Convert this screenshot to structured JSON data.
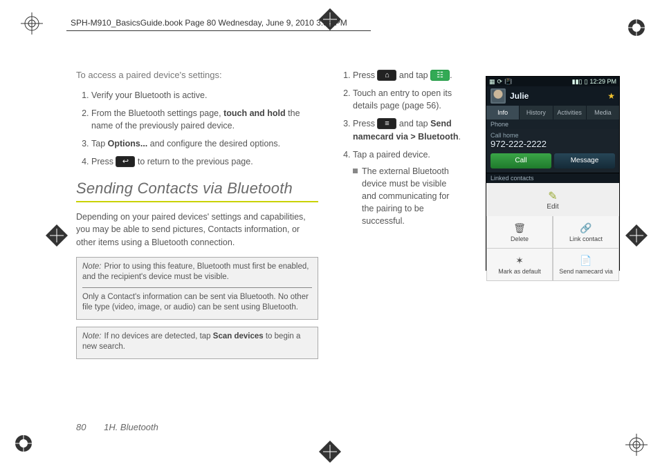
{
  "header": {
    "running_head": "SPH-M910_BasicsGuide.book  Page 80  Wednesday, June 9, 2010  3:56 PM"
  },
  "left_col": {
    "intro": "To access a paired device's settings:",
    "steps": [
      {
        "n": "1.",
        "text": "Verify your Bluetooth is active."
      },
      {
        "n": "2.",
        "text_a": "From the Bluetooth settings page, ",
        "bold": "touch and hold",
        "text_b": " the name of the previously paired device."
      },
      {
        "n": "3.",
        "text_a": "Tap ",
        "bold": "Options...",
        "text_b": " and configure the desired options."
      },
      {
        "n": "4.",
        "text_a": "Press ",
        "icon": "back-key-icon",
        "icon_glyph": "↩",
        "text_b": " to return to the previous page."
      }
    ],
    "section_title": "Sending Contacts via Bluetooth",
    "section_body": "Depending on your paired devices' settings and capabilities, you may be able to send pictures, Contacts information, or other items using a Bluetooth connection.",
    "note1_label": "Note:",
    "note1_p1": "Prior to using this feature, Bluetooth must first be enabled, and the recipient's device must be visible.",
    "note1_p2": "Only a Contact's information can be sent via Bluetooth. No other file type (video, image, or audio) can be sent using Bluetooth.",
    "note2_label": "Note:",
    "note2_p1_a": "If no devices are detected, tap ",
    "note2_p1_bold": "Scan devices",
    "note2_p1_b": " to begin a new search."
  },
  "right_col": {
    "steps": [
      {
        "n": "1.",
        "text_a": "Press ",
        "icon1": "home-key-icon",
        "icon1_glyph": "⌂",
        "text_mid": " and tap ",
        "icon2": "contacts-key-icon",
        "icon2_glyph": "☷",
        "text_b": "."
      },
      {
        "n": "2.",
        "text": "Touch an entry to open its details page (page 56)."
      },
      {
        "n": "3.",
        "text_a": "Press ",
        "icon": "menu-key-icon",
        "icon_glyph": "≡",
        "text_mid": " and tap ",
        "bold": "Send namecard via > Bluetooth",
        "text_b": "."
      },
      {
        "n": "4.",
        "text": "Tap a paired device.",
        "bullet": "The external Bluetooth device must be visible and communicating for the pairing to be successful."
      }
    ]
  },
  "phone": {
    "status": {
      "time": "12:29 PM",
      "icons_left": [
        "menu",
        "sync",
        "vibrate"
      ],
      "icons_right": [
        "signal",
        "battery"
      ]
    },
    "contact_name": "Julie",
    "tabs": [
      "Info",
      "History",
      "Activities",
      "Media"
    ],
    "active_tab": 0,
    "section1": "Phone",
    "call_label": "Call home",
    "phone_number": "972-222-2222",
    "btn_call": "Call",
    "btn_msg": "Message",
    "section2": "Linked contacts",
    "edit_label": "Edit",
    "grid": [
      {
        "icon": "🗑",
        "label": "Delete"
      },
      {
        "icon": "🔗",
        "label": "Link contact"
      },
      {
        "icon": "✶",
        "label": "Mark as default"
      },
      {
        "icon": "📄",
        "label": "Send namecard via"
      }
    ]
  },
  "footer": {
    "page_number": "80",
    "section_label": "1H. Bluetooth"
  }
}
